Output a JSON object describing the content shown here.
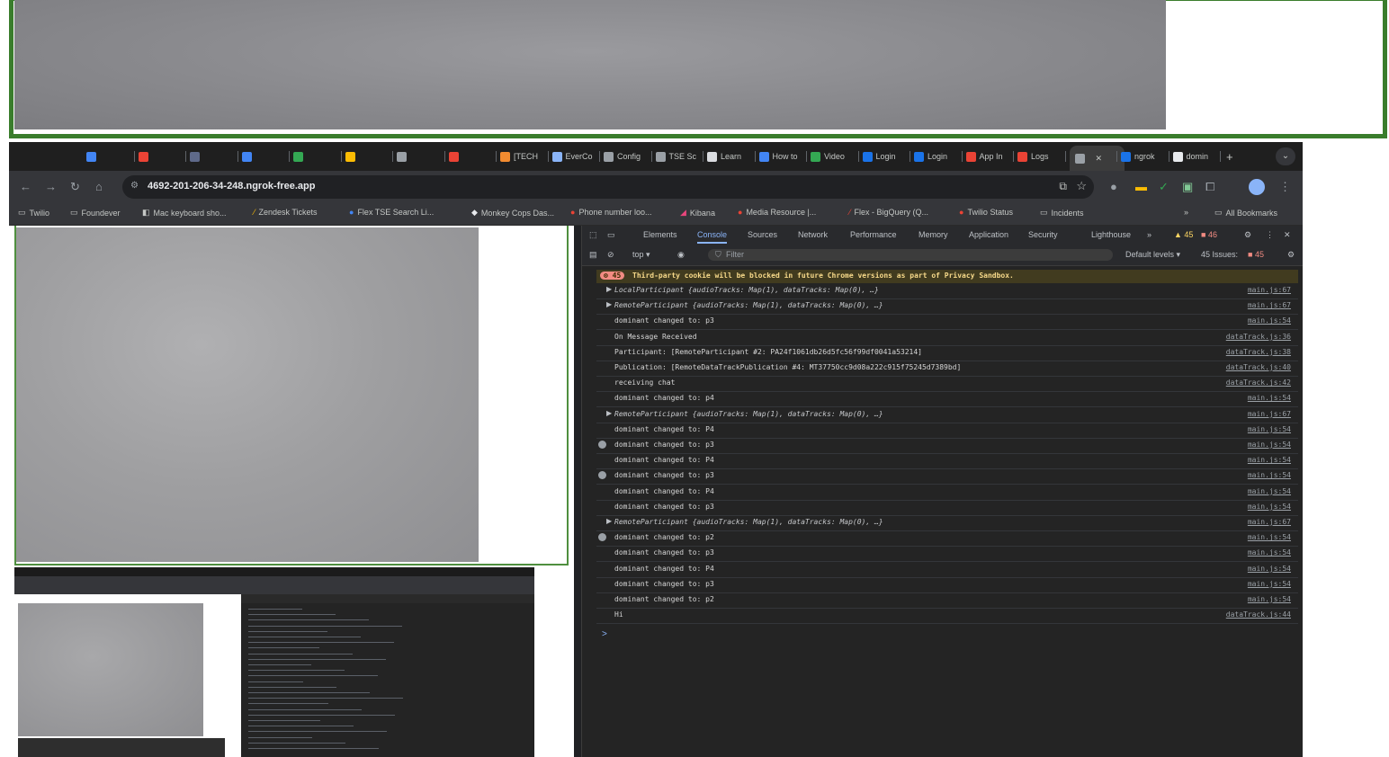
{
  "browser": {
    "tabs": [
      {
        "label": "",
        "color": "#4285f4"
      },
      {
        "label": "",
        "color": "#ea4335"
      },
      {
        "label": "",
        "color": "#5f6a8a"
      },
      {
        "label": "",
        "color": "#4285f4"
      },
      {
        "label": "",
        "color": "#34a853"
      },
      {
        "label": "",
        "color": "#fbbc04"
      },
      {
        "label": "",
        "color": "#9aa0a6"
      },
      {
        "label": "",
        "color": "#ea4335"
      },
      {
        "label": "[TECH",
        "color": "#f28b30"
      },
      {
        "label": "EverCo",
        "color": "#8ab4f8"
      },
      {
        "label": "Config",
        "color": "#9aa0a6"
      },
      {
        "label": "TSE Sc",
        "color": "#9aa0a6"
      },
      {
        "label": "Learn",
        "color": "#dadce0"
      },
      {
        "label": "How to",
        "color": "#4285f4"
      },
      {
        "label": "Video",
        "color": "#34a853"
      },
      {
        "label": "Login",
        "color": "#1a73e8"
      },
      {
        "label": "Login",
        "color": "#1a73e8"
      },
      {
        "label": "App In",
        "color": "#ea4335"
      },
      {
        "label": "Logs",
        "color": "#ea4335"
      },
      {
        "label": "",
        "color": "#9aa0a6"
      },
      {
        "label": "ngrok",
        "color": "#1a73e8"
      },
      {
        "label": "domin",
        "color": "#e8eaed"
      }
    ],
    "url": "4692-201-206-34-248.ngrok-free.app",
    "bookmarks": [
      {
        "label": "Twilio",
        "icon": "folder-icon"
      },
      {
        "label": "Foundever",
        "icon": "folder-icon"
      },
      {
        "label": "Mac keyboard sho...",
        "icon": "page-icon"
      },
      {
        "label": "Zendesk Tickets",
        "icon": "zendesk-icon"
      },
      {
        "label": "Flex TSE Search Li...",
        "icon": "circle-icon"
      },
      {
        "label": "Monkey Cops Das...",
        "icon": "monkey-icon"
      },
      {
        "label": "Phone number loo...",
        "icon": "circle-icon"
      },
      {
        "label": "Kibana",
        "icon": "kibana-icon"
      },
      {
        "label": "Media Resource |...",
        "icon": "circle-icon"
      },
      {
        "label": "Flex - BigQuery (Q...",
        "icon": "flex-icon"
      },
      {
        "label": "Twilio Status",
        "icon": "circle-icon"
      },
      {
        "label": "Incidents",
        "icon": "folder-icon"
      }
    ],
    "bookmarks_overflow": "»",
    "all_bookmarks": "All Bookmarks"
  },
  "devtools": {
    "tabs": [
      "Elements",
      "Console",
      "Sources",
      "Network",
      "Performance",
      "Memory",
      "Application",
      "Security",
      "Lighthouse",
      "»"
    ],
    "warnings": "45",
    "errors": "46",
    "context": "top ▾",
    "filter_placeholder": "Filter",
    "levels": "Default levels ▾",
    "issues": "45 Issues:",
    "issues_count": "45",
    "cookie_badge": "45",
    "cookie_message": "Third-party cookie will be blocked in future Chrome versions as part of Privacy Sandbox.",
    "log": [
      {
        "msg": "LocalParticipant {audioTracks: Map(1), dataTracks: Map(0), …}",
        "src": "main.js:67",
        "expand": true,
        "obj": true
      },
      {
        "msg": "RemoteParticipant {audioTracks: Map(1), dataTracks: Map(0), …}",
        "src": "main.js:67",
        "expand": true,
        "obj": true
      },
      {
        "msg": "dominant changed to:  p3",
        "src": "main.js:54"
      },
      {
        "msg": "On Message Received",
        "src": "dataTrack.js:36"
      },
      {
        "msg": "Participant: [RemoteParticipant #2: PA24f1061db26d5fc56f99df0041a53214]",
        "src": "dataTrack.js:38"
      },
      {
        "msg": "Publication: [RemoteDataTrackPublication #4: MT37750cc9d08a222c915f75245d7389bd]",
        "src": "dataTrack.js:40"
      },
      {
        "msg": "receiving chat",
        "src": "dataTrack.js:42"
      },
      {
        "msg": "dominant changed to:  p4",
        "src": "main.js:54"
      },
      {
        "msg": "RemoteParticipant {audioTracks: Map(1), dataTracks: Map(0), …}",
        "src": "main.js:67",
        "expand": true,
        "obj": true
      },
      {
        "msg": "dominant changed to:  P4",
        "src": "main.js:54"
      },
      {
        "msg": "dominant changed to:  p3",
        "src": "main.js:54",
        "count": true
      },
      {
        "msg": "dominant changed to:  P4",
        "src": "main.js:54"
      },
      {
        "msg": "dominant changed to:  p3",
        "src": "main.js:54",
        "count": true
      },
      {
        "msg": "dominant changed to:  P4",
        "src": "main.js:54"
      },
      {
        "msg": "dominant changed to:  p3",
        "src": "main.js:54"
      },
      {
        "msg": "RemoteParticipant {audioTracks: Map(1), dataTracks: Map(0), …}",
        "src": "main.js:67",
        "expand": true,
        "obj": true
      },
      {
        "msg": "dominant changed to:  p2",
        "src": "main.js:54",
        "count": true
      },
      {
        "msg": "dominant changed to:  p3",
        "src": "main.js:54"
      },
      {
        "msg": "dominant changed to:  P4",
        "src": "main.js:54"
      },
      {
        "msg": "dominant changed to:  p3",
        "src": "main.js:54"
      },
      {
        "msg": "dominant changed to:  p2",
        "src": "main.js:54"
      },
      {
        "msg": "Hi",
        "src": "dataTrack.js:44"
      }
    ],
    "prompt": ">"
  }
}
